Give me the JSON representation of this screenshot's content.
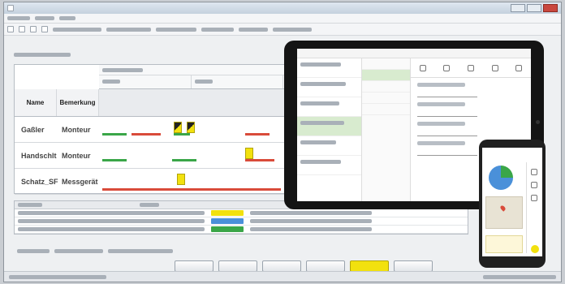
{
  "window": {
    "title": ""
  },
  "grid": {
    "columns": {
      "name": "Name",
      "role": "Bemerkung"
    },
    "resources": [
      {
        "name": "Gaßler",
        "role": "Monteur"
      },
      {
        "name": "Handschlt",
        "role": "Monteur"
      },
      {
        "name": "Schatz_SF",
        "role": "Messgerät"
      }
    ]
  },
  "colors": {
    "accent": "#f2e10e",
    "ok": "#3aa648",
    "alert": "#d94b3a",
    "info": "#4a90d9"
  },
  "note": ""
}
